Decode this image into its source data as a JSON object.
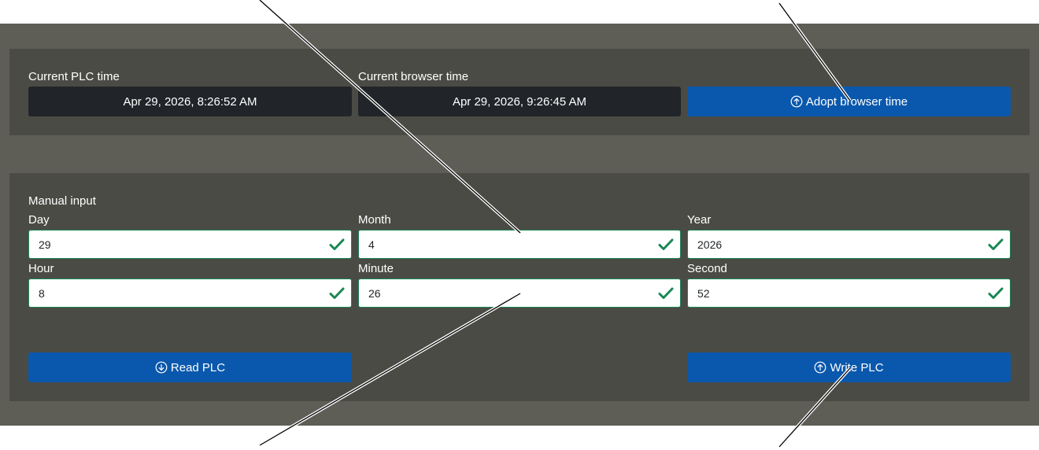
{
  "time_panel": {
    "plc_label": "Current PLC time",
    "plc_value": "Apr 29, 2026, 8:26:52 AM",
    "browser_label": "Current browser time",
    "browser_value": "Apr 29, 2026, 9:26:45 AM",
    "adopt_button": "Adopt browser time",
    "adopt_icon": "arrow-up-circle-icon"
  },
  "manual_panel": {
    "title": "Manual input",
    "fields": {
      "day": {
        "label": "Day",
        "value": "29"
      },
      "month": {
        "label": "Month",
        "value": "4"
      },
      "year": {
        "label": "Year",
        "value": "2026"
      },
      "hour": {
        "label": "Hour",
        "value": "8"
      },
      "minute": {
        "label": "Minute",
        "value": "26"
      },
      "second": {
        "label": "Second",
        "value": "52"
      }
    },
    "read_button": "Read PLC",
    "read_icon": "arrow-down-circle-icon",
    "write_button": "Write PLC",
    "write_icon": "arrow-up-circle-icon"
  },
  "colors": {
    "frame": "#5f5e56",
    "panel": "#4b4b45",
    "display_bg": "#212529",
    "button_bg": "#0a58ad",
    "valid_green": "#198754"
  }
}
